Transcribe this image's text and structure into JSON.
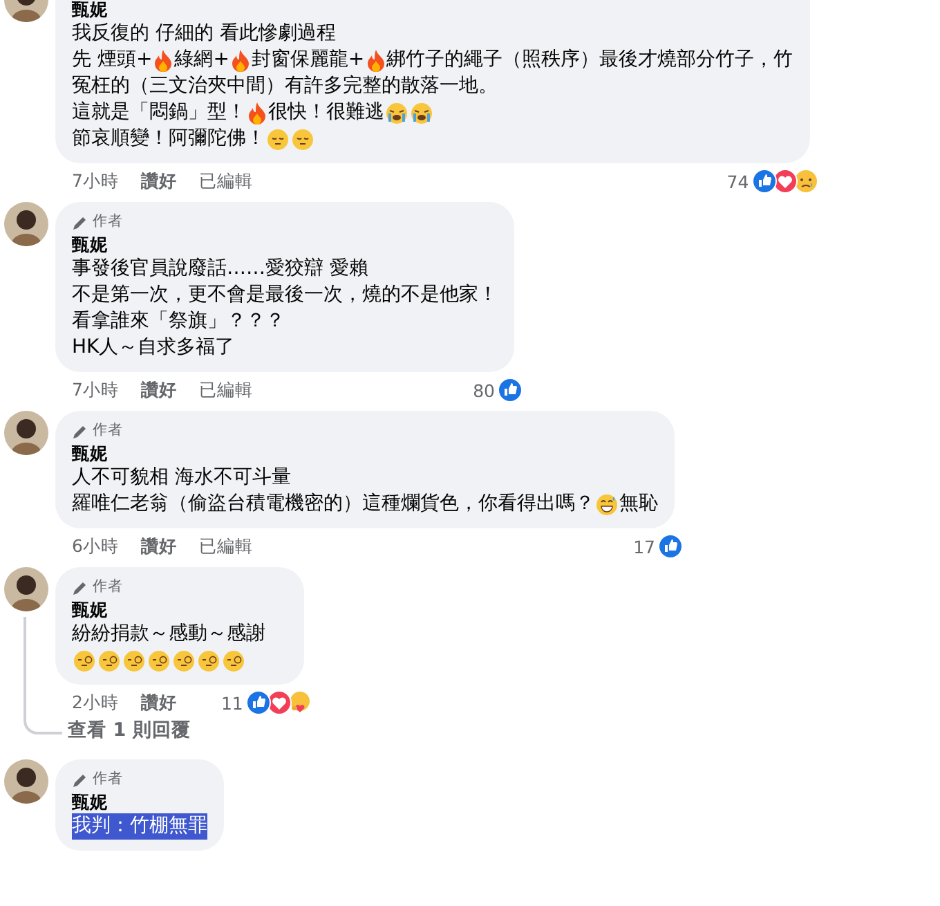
{
  "comments": [
    {
      "name": "甄妮",
      "lines": [
        [
          {
            "kind": "text",
            "text": "我反復的 仔細的 看此慘劇過程"
          }
        ],
        [
          {
            "kind": "text",
            "text": "先 煙頭+"
          },
          {
            "kind": "fire"
          },
          {
            "kind": "text",
            "text": "綠網+"
          },
          {
            "kind": "fire"
          },
          {
            "kind": "text",
            "text": "封窗保麗龍+"
          },
          {
            "kind": "fire"
          },
          {
            "kind": "text",
            "text": "綁竹子的繩子（照秩序）最後才燒部分竹子，竹"
          }
        ],
        [
          {
            "kind": "text",
            "text": "冤枉的（三文治夾中間）有許多完整的散落一地。"
          }
        ],
        [
          {
            "kind": "text",
            "text": "這就是「悶鍋」型！"
          },
          {
            "kind": "fire"
          },
          {
            "kind": "text",
            "text": "很快！很難逃"
          },
          {
            "kind": "crying"
          },
          {
            "kind": "crying"
          }
        ],
        [
          {
            "kind": "text",
            "text": "節哀順變！阿彌陀佛！"
          },
          {
            "kind": "pensive"
          },
          {
            "kind": "pensive"
          }
        ]
      ],
      "time": "7小時",
      "like": "讚好",
      "edited": "已編輯",
      "count": "74",
      "reactions": [
        {
          "kind": "like"
        },
        {
          "kind": "love"
        },
        {
          "kind": "sad"
        }
      ]
    },
    {
      "badge": "作者",
      "name": "甄妮",
      "lines": [
        [
          {
            "kind": "text",
            "text": "事發後官員說廢話……愛狡辯 愛賴"
          }
        ],
        [
          {
            "kind": "text",
            "text": "不是第一次，更不會是最後一次，燒的不是他家！"
          }
        ],
        [
          {
            "kind": "text",
            "text": "看拿誰來「祭旗」？？？"
          }
        ],
        [
          {
            "kind": "text",
            "text": "HK人～自求多福了"
          }
        ]
      ],
      "time": "7小時",
      "like": "讚好",
      "edited": "已編輯",
      "count": "80",
      "reactions": [
        {
          "kind": "like"
        }
      ]
    },
    {
      "badge": "作者",
      "name": "甄妮",
      "lines": [
        [
          {
            "kind": "text",
            "text": "人不可貌相 海水不可斗量"
          }
        ],
        [
          {
            "kind": "text",
            "text": "羅唯仁老翁（偷盜台積電機密的）這種爛貨色，你看得出嗎？"
          },
          {
            "kind": "grin"
          },
          {
            "kind": "text",
            "text": "無恥"
          }
        ]
      ],
      "time": "6小時",
      "like": "讚好",
      "edited": "已編輯",
      "count": "17",
      "reactions": [
        {
          "kind": "like"
        }
      ]
    },
    {
      "badge": "作者",
      "name": "甄妮",
      "lines": [
        [
          {
            "kind": "text",
            "text": "紛紛捐款～感動～感謝"
          }
        ],
        [
          {
            "kind": "monocle"
          },
          {
            "kind": "monocle"
          },
          {
            "kind": "monocle"
          },
          {
            "kind": "monocle"
          },
          {
            "kind": "monocle"
          },
          {
            "kind": "monocle"
          },
          {
            "kind": "monocle"
          }
        ]
      ],
      "time": "2小時",
      "like": "讚好",
      "count": "11",
      "reactions": [
        {
          "kind": "like"
        },
        {
          "kind": "love"
        },
        {
          "kind": "care"
        }
      ],
      "replies_link": "查看 1 則回覆"
    },
    {
      "badge": "作者",
      "name": "甄妮",
      "lines": [
        [
          {
            "kind": "text",
            "text": "我判：竹棚無罪",
            "highlighted": true
          }
        ]
      ]
    }
  ]
}
